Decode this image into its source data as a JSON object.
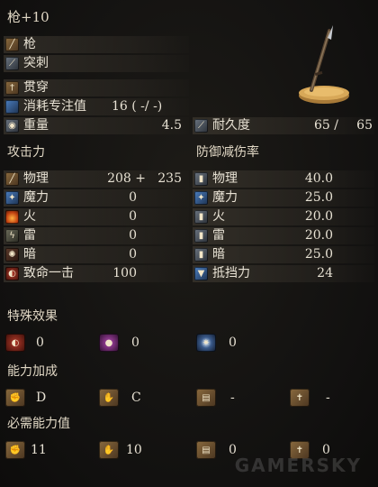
{
  "item": {
    "name": "枪+10",
    "weapon_type": "枪",
    "attack_type": "突刺",
    "skill": "贯穿",
    "fp_cost_label": "消耗专注值",
    "fp_cost_value": "16 (  -/  -)",
    "weight_label": "重量",
    "weight_value": "4.5",
    "durability_label": "耐久度",
    "durability_current": "65 /",
    "durability_max": "65"
  },
  "attack": {
    "header": "攻击力",
    "rows": [
      {
        "label": "物理",
        "value": "208 +",
        "value2": "235",
        "icon": "physical-icon"
      },
      {
        "label": "魔力",
        "value": "0",
        "value2": "",
        "icon": "magic-icon"
      },
      {
        "label": "火",
        "value": "0",
        "value2": "",
        "icon": "fire-icon"
      },
      {
        "label": "雷",
        "value": "0",
        "value2": "",
        "icon": "lightning-icon"
      },
      {
        "label": "暗",
        "value": "0",
        "value2": "",
        "icon": "dark-icon"
      },
      {
        "label": "致命一击",
        "value": "100",
        "value2": "",
        "icon": "critical-icon"
      }
    ]
  },
  "defense": {
    "header": "防御减伤率",
    "rows": [
      {
        "label": "物理",
        "value": "40.0",
        "icon": "physical-defense-icon"
      },
      {
        "label": "魔力",
        "value": "25.0",
        "icon": "magic-defense-icon"
      },
      {
        "label": "火",
        "value": "20.0",
        "icon": "fire-defense-icon"
      },
      {
        "label": "雷",
        "value": "20.0",
        "icon": "lightning-defense-icon"
      },
      {
        "label": "暗",
        "value": "25.0",
        "icon": "dark-defense-icon"
      },
      {
        "label": "抵挡力",
        "value": "24",
        "icon": "stability-icon"
      }
    ]
  },
  "effects": {
    "header": "特殊效果",
    "values": [
      "0",
      "0",
      "0"
    ]
  },
  "scaling": {
    "header": "能力加成",
    "values": [
      "D",
      "C",
      "-",
      "-"
    ]
  },
  "requirements": {
    "header": "必需能力值",
    "values": [
      "11",
      "10",
      "0",
      "0"
    ]
  },
  "watermark": "GAMERSKY"
}
